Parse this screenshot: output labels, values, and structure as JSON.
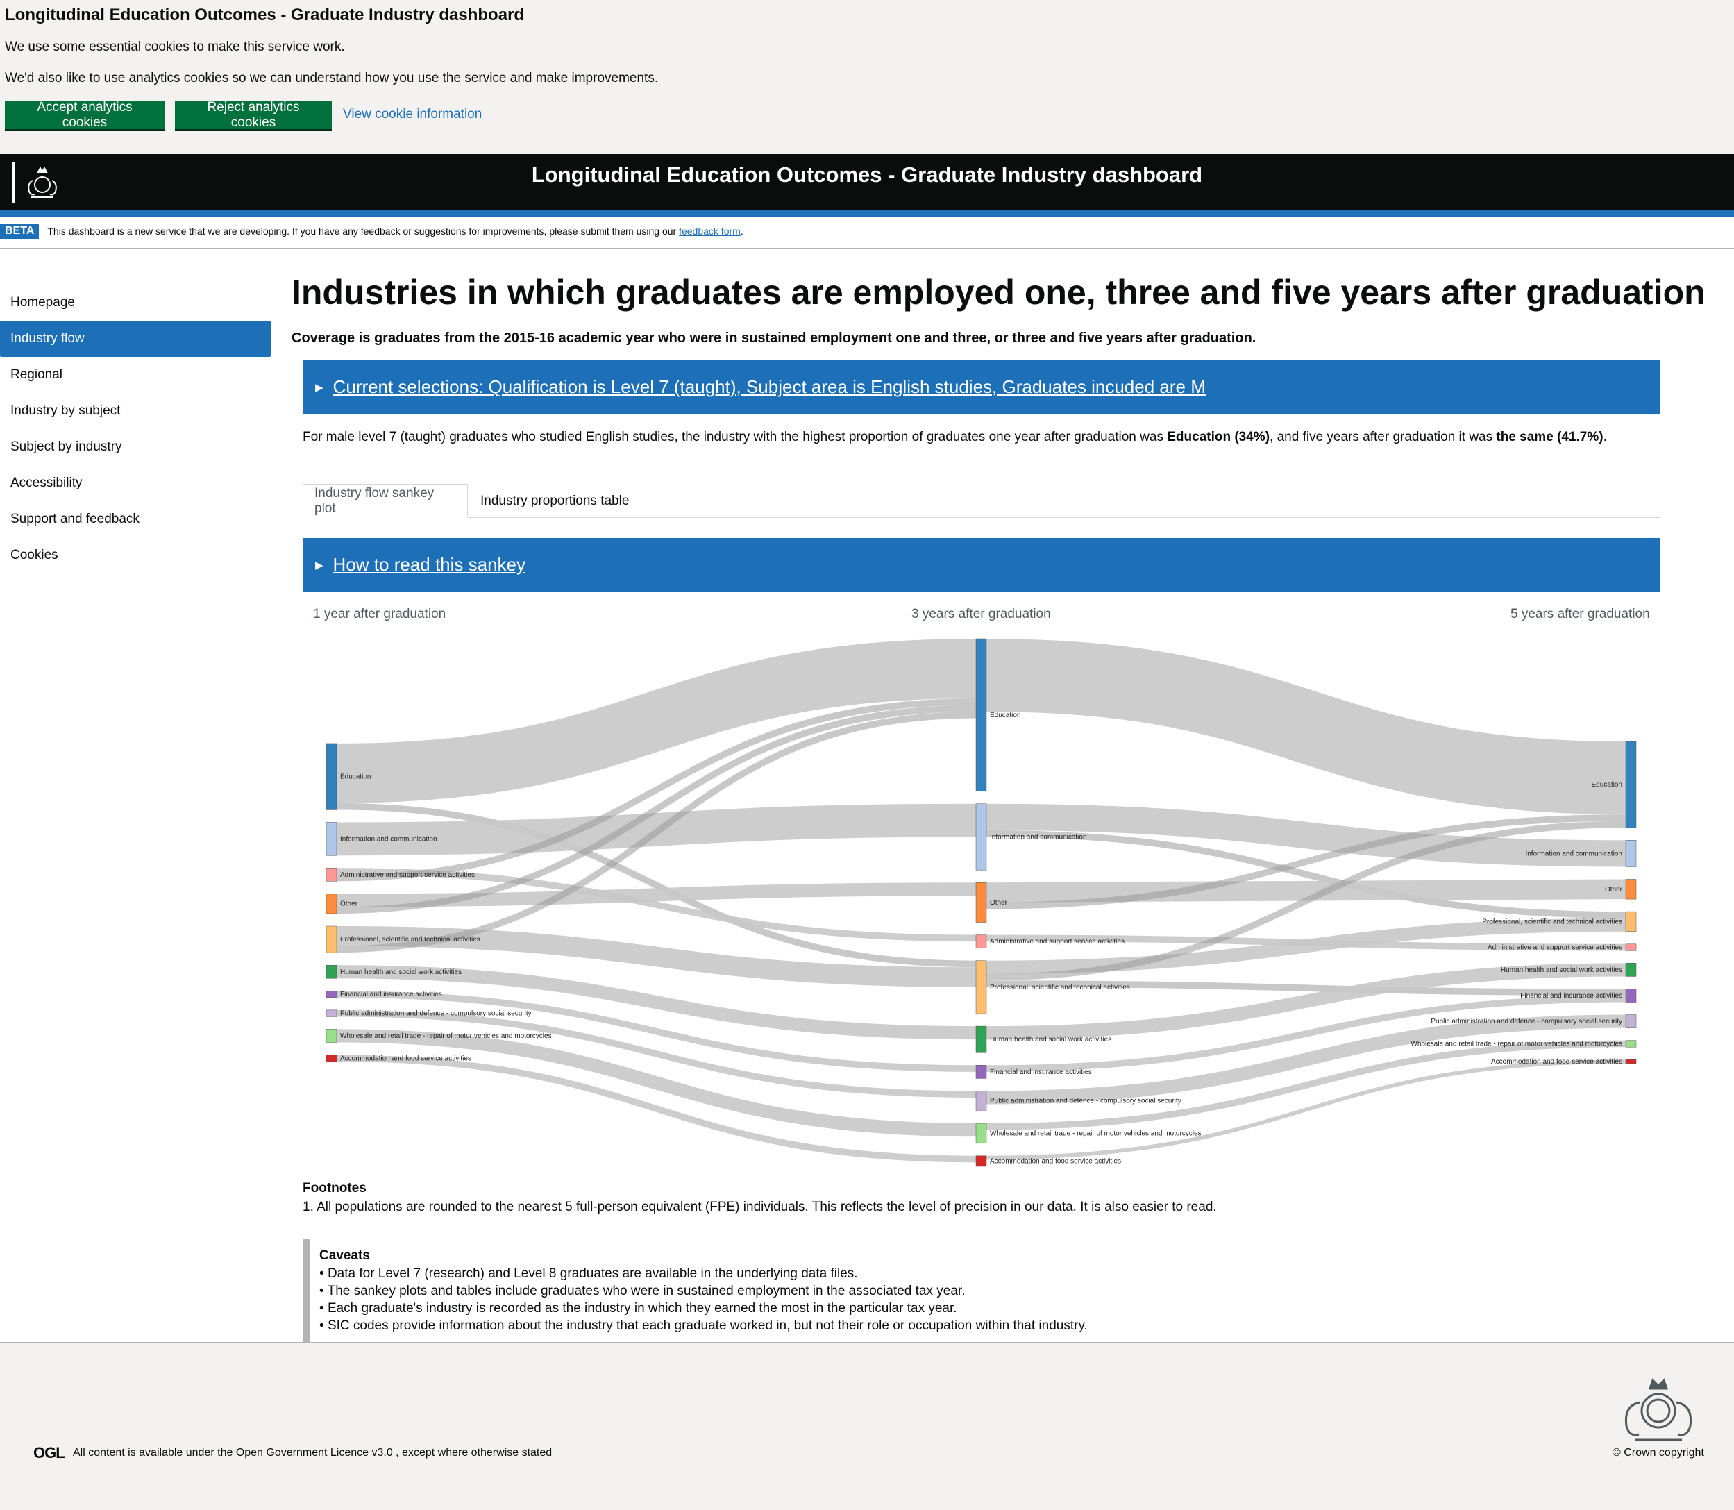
{
  "cookie_banner": {
    "title": "Longitudinal Education Outcomes - Graduate Industry dashboard",
    "line1": "We use some essential cookies to make this service work.",
    "line2": "We'd also like to use analytics cookies so we can understand how you use the service and make improvements.",
    "accept_label": "Accept analytics cookies",
    "reject_label": "Reject analytics cookies",
    "info_label": "View cookie information"
  },
  "header": {
    "title": "Longitudinal Education Outcomes - Graduate Industry dashboard",
    "logo_icon": "royal-crest-icon"
  },
  "beta": {
    "tag": "BETA",
    "message": "This dashboard is a new service that we are developing. If you have any feedback or suggestions for improvements, please submit them using our",
    "link": "feedback form",
    "after": "."
  },
  "sidebar": {
    "items": [
      {
        "label": "Homepage"
      },
      {
        "label": "Industry flow"
      },
      {
        "label": "Regional"
      },
      {
        "label": "Industry by subject"
      },
      {
        "label": "Subject by industry"
      },
      {
        "label": "Accessibility"
      },
      {
        "label": "Support and feedback"
      },
      {
        "label": "Cookies"
      }
    ],
    "active_index": 1
  },
  "main": {
    "title": "Industries in which graduates are employed one, three and five years after graduation",
    "coverage": "Coverage is graduates from the 2015-16 academic year who were in sustained employment one and three, or three and five years after graduation.",
    "selections": "Current selections: Qualification is Level 7 (taught), Subject area is English studies, Graduates incuded are M",
    "summary": {
      "pre": "For male level 7 (taught) graduates who studied English studies, the industry with the highest proportion of graduates one year after graduation was ",
      "bold1": "Education (34%)",
      "mid": ", and five years after graduation it was ",
      "bold2": "the same (41.7%)",
      "post": "."
    },
    "tabs": [
      {
        "label": "Industry flow sankey plot",
        "selected": true
      },
      {
        "label": "Industry proportions table",
        "selected": false
      }
    ],
    "how_to_read": "How to read this sankey",
    "stages": [
      "1 year after graduation",
      "3 years after graduation",
      "5 years after graduation"
    ],
    "footnotes_title": "Footnotes",
    "footnote_1": "1. All populations are rounded to the nearest 5 full-person equivalent (FPE) individuals. This reflects the level of precision in our data. It is also easier to read.",
    "caveats_title": "Caveats",
    "caveats": [
      "Data for Level 7 (research) and Level 8 graduates are available in the underlying data files.",
      "The sankey plots and tables include graduates who were in sustained employment in the associated tax year.",
      "Each graduate's industry is recorded as the industry in which they earned the most in the particular tax year.",
      "SIC codes provide information about the industry that each graduate worked in, but not their role or occupation within that industry."
    ]
  },
  "colors": {
    "Education": "#3182bd",
    "Information and communication": "#aec7e8",
    "Administrative and support service activities": "#ff9896",
    "Other": "#fd8d3c",
    "Professional, scientific and technical activities": "#fdbf6f",
    "Human health and social work activities": "#31a354",
    "Financial and insurance activities": "#9467bd",
    "Public administration and defence - compulsory social security": "#c5b0d5",
    "Wholesale and retail trade - repair of motor vehicles and motorcycles": "#98df8a",
    "Accommodation and food service activities": "#d62728"
  },
  "chart_data": {
    "type": "sankey",
    "stages": [
      "1 year after graduation",
      "3 years after graduation",
      "5 years after graduation"
    ],
    "nodes": [
      [
        "Education",
        "Information and communication",
        "Administrative and support service activities",
        "Other",
        "Professional, scientific and technical activities",
        "Human health and social work activities",
        "Financial and insurance activities",
        "Public administration and defence - compulsory social security",
        "Wholesale and retail trade - repair of motor vehicles and motorcycles",
        "Accommodation and food service activities"
      ],
      [
        "Education",
        "Information and communication",
        "Other",
        "Administrative and support service activities",
        "Professional, scientific and technical activities",
        "Human health and social work activities",
        "Financial and insurance activities",
        "Public administration and defence - compulsory social security",
        "Wholesale and retail trade - repair of motor vehicles and motorcycles",
        "Accommodation and food service activities"
      ],
      [
        "Education",
        "Information and communication",
        "Other",
        "Professional, scientific and technical activities",
        "Administrative and support service activities",
        "Human health and social work activities",
        "Financial and insurance activities",
        "Public administration and defence - compulsory social security",
        "Wholesale and retail trade - repair of motor vehicles and motorcycles",
        "Accommodation and food service activities"
      ]
    ],
    "links": [
      {
        "stage": 0,
        "source": "Education",
        "target": "Education",
        "value": 45
      },
      {
        "stage": 0,
        "source": "Education",
        "target": "Professional, scientific and technical activities",
        "value": 5
      },
      {
        "stage": 0,
        "source": "Information and communication",
        "target": "Information and communication",
        "value": 25
      },
      {
        "stage": 0,
        "source": "Administrative and support service activities",
        "target": "Administrative and support service activities",
        "value": 5
      },
      {
        "stage": 0,
        "source": "Administrative and support service activities",
        "target": "Education",
        "value": 5
      },
      {
        "stage": 0,
        "source": "Other",
        "target": "Other",
        "value": 10
      },
      {
        "stage": 0,
        "source": "Other",
        "target": "Education",
        "value": 5
      },
      {
        "stage": 0,
        "source": "Professional, scientific and technical activities",
        "target": "Professional, scientific and technical activities",
        "value": 15
      },
      {
        "stage": 0,
        "source": "Professional, scientific and technical activities",
        "target": "Education",
        "value": 5
      },
      {
        "stage": 0,
        "source": "Human health and social work activities",
        "target": "Human health and social work activities",
        "value": 10
      },
      {
        "stage": 0,
        "source": "Financial and insurance activities",
        "target": "Financial and insurance activities",
        "value": 5
      },
      {
        "stage": 0,
        "source": "Public administration and defence - compulsory social security",
        "target": "Public administration and defence - compulsory social security",
        "value": 5
      },
      {
        "stage": 0,
        "source": "Wholesale and retail trade - repair of motor vehicles and motorcycles",
        "target": "Wholesale and retail trade - repair of motor vehicles and motorcycles",
        "value": 10
      },
      {
        "stage": 0,
        "source": "Accommodation and food service activities",
        "target": "Accommodation and food service activities",
        "value": 5
      },
      {
        "stage": 1,
        "source": "Education",
        "target": "Education",
        "value": 55
      },
      {
        "stage": 1,
        "source": "Information and communication",
        "target": "Information and communication",
        "value": 20
      },
      {
        "stage": 1,
        "source": "Information and communication",
        "target": "Professional, scientific and technical activities",
        "value": 5
      },
      {
        "stage": 1,
        "source": "Other",
        "target": "Other",
        "value": 15
      },
      {
        "stage": 1,
        "source": "Other",
        "target": "Education",
        "value": 5
      },
      {
        "stage": 1,
        "source": "Administrative and support service activities",
        "target": "Administrative and support service activities",
        "value": 5
      },
      {
        "stage": 1,
        "source": "Professional, scientific and technical activities",
        "target": "Professional, scientific and technical activities",
        "value": 10
      },
      {
        "stage": 1,
        "source": "Professional, scientific and technical activities",
        "target": "Education",
        "value": 5
      },
      {
        "stage": 1,
        "source": "Professional, scientific and technical activities",
        "target": "Financial and insurance activities",
        "value": 5
      },
      {
        "stage": 1,
        "source": "Human health and social work activities",
        "target": "Human health and social work activities",
        "value": 10
      },
      {
        "stage": 1,
        "source": "Financial and insurance activities",
        "target": "Financial and insurance activities",
        "value": 5
      },
      {
        "stage": 1,
        "source": "Public administration and defence - compulsory social security",
        "target": "Public administration and defence - compulsory social security",
        "value": 10
      },
      {
        "stage": 1,
        "source": "Wholesale and retail trade - repair of motor vehicles and motorcycles",
        "target": "Wholesale and retail trade - repair of motor vehicles and motorcycles",
        "value": 5
      },
      {
        "stage": 1,
        "source": "Accommodation and food service activities",
        "target": "Accommodation and food service activities",
        "value": 3
      }
    ]
  },
  "footer": {
    "ogl": "OGL",
    "licence_pre": "All content is available under the ",
    "licence_link": "Open Government Licence v3.0",
    "licence_post": " , except where otherwise stated",
    "crown": "© Crown copyright",
    "crest_icon": "royal-coat-of-arms-icon"
  }
}
